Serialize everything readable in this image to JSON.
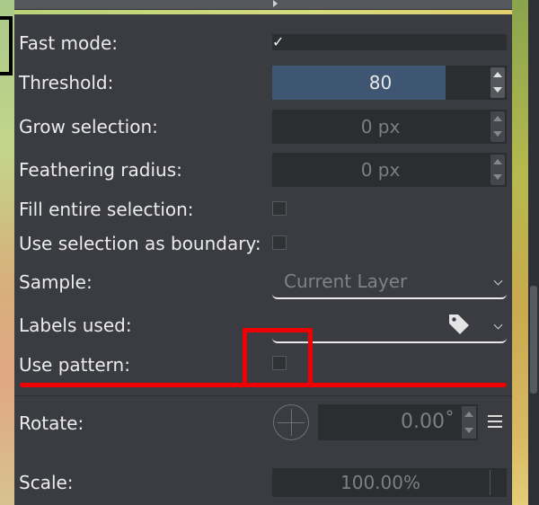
{
  "fields": {
    "fast_mode": {
      "label": "Fast mode:",
      "checked_glyph": "✓"
    },
    "threshold": {
      "label": "Threshold:",
      "value": "80",
      "fill_fraction": 0.8
    },
    "grow_selection": {
      "label": "Grow selection:",
      "value": "0 px"
    },
    "feathering_radius": {
      "label": "Feathering radius:",
      "value": "0 px"
    },
    "fill_entire_selection": {
      "label": "Fill entire selection:"
    },
    "use_selection_as_boundary": {
      "label": "Use selection as boundary:"
    },
    "sample": {
      "label": "Sample:",
      "value": "Current Layer"
    },
    "labels_used": {
      "label": "Labels used:",
      "icon": "tag-icon"
    },
    "use_pattern": {
      "label": "Use pattern:"
    },
    "rotate": {
      "label": "Rotate:",
      "value": "0.00˚"
    },
    "scale": {
      "label": "Scale:",
      "value": "100.00%"
    }
  },
  "colors": {
    "panel_bg": "#3a3c42",
    "field_bg": "#2b2d31",
    "threshold_fill": "#3f5673",
    "annotation_red": "#f00000"
  }
}
